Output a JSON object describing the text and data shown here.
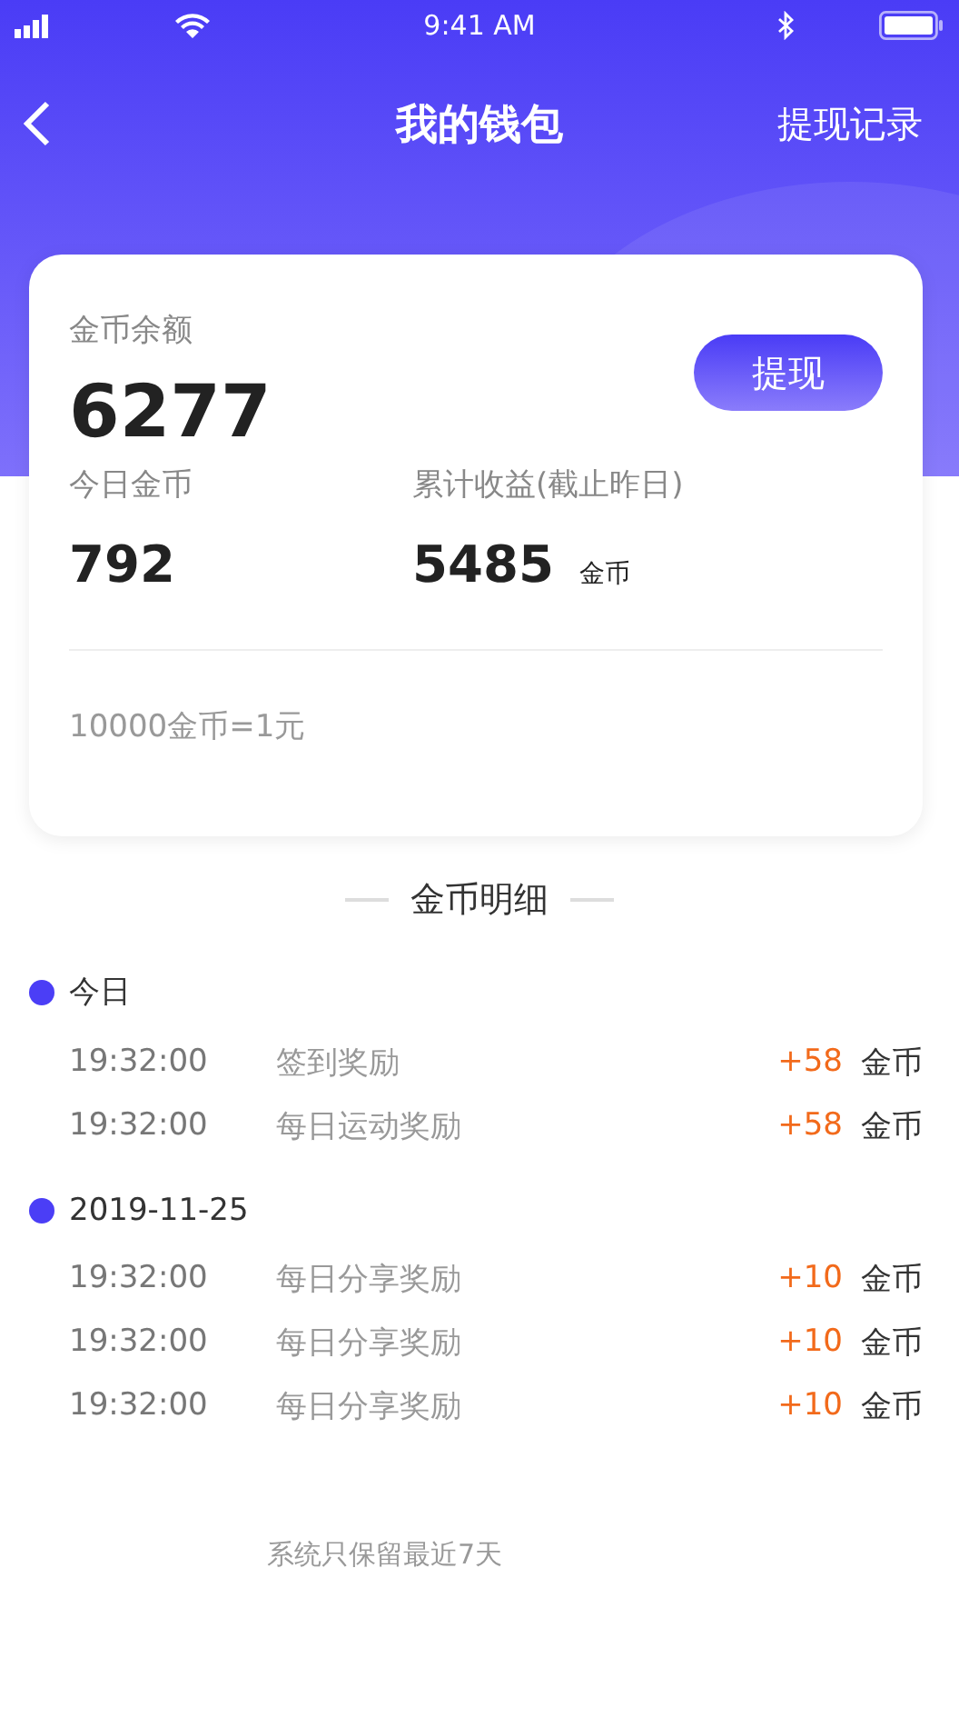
{
  "status_bar": {
    "time": "9:41 AM"
  },
  "nav": {
    "title": "我的钱包",
    "action": "提现记录"
  },
  "balance_card": {
    "label": "金币余额",
    "amount": "6277",
    "withdraw_button": "提现",
    "stats": [
      {
        "label": "今日金币",
        "value": "792"
      },
      {
        "label": "累计收益(截止昨日)",
        "value": "5485",
        "unit": "金币"
      }
    ],
    "rate_note": "10000金币=1元"
  },
  "section_title": "金币明细",
  "groups": [
    {
      "date": "今日",
      "color": "#4b3ef6",
      "entries": [
        {
          "time": "19:32:00",
          "title": "签到奖励",
          "amount": "+58",
          "unit": "金币"
        },
        {
          "time": "19:32:00",
          "title": "每日运动奖励",
          "amount": "+58",
          "unit": "金币"
        }
      ]
    },
    {
      "date": "2019-11-25",
      "color": "#4b3ef6",
      "entries": [
        {
          "time": "19:32:00",
          "title": "每日分享奖励",
          "amount": "+10",
          "unit": "金币"
        },
        {
          "time": "19:32:00",
          "title": "每日分享奖励",
          "amount": "+10",
          "unit": "金币"
        },
        {
          "time": "19:32:00",
          "title": "每日分享奖励",
          "amount": "+10",
          "unit": "金币"
        }
      ]
    }
  ],
  "footer_note": "系统只保留最近7天"
}
